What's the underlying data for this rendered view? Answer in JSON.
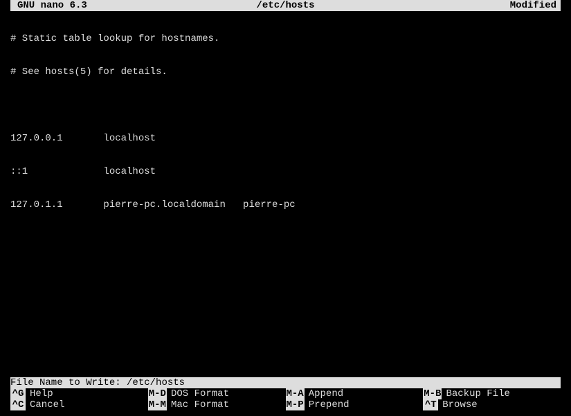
{
  "titlebar": {
    "app": "GNU nano 6.3",
    "file": "/etc/hosts",
    "status": "Modified"
  },
  "content": [
    "# Static table lookup for hostnames.",
    "# See hosts(5) for details.",
    "",
    "127.0.0.1       localhost",
    "::1             localhost",
    "127.0.1.1       pierre-pc.localdomain   pierre-pc"
  ],
  "prompt": {
    "label": "File Name to Write: ",
    "value": "/etc/hosts"
  },
  "help": {
    "row1": [
      {
        "key": "^G",
        "label": "Help"
      },
      {
        "key": "M-D",
        "label": "DOS Format"
      },
      {
        "key": "M-A",
        "label": "Append"
      },
      {
        "key": "M-B",
        "label": "Backup File"
      }
    ],
    "row2": [
      {
        "key": "^C",
        "label": "Cancel"
      },
      {
        "key": "M-M",
        "label": "Mac Format"
      },
      {
        "key": "M-P",
        "label": "Prepend"
      },
      {
        "key": "^T",
        "label": "Browse"
      }
    ]
  }
}
